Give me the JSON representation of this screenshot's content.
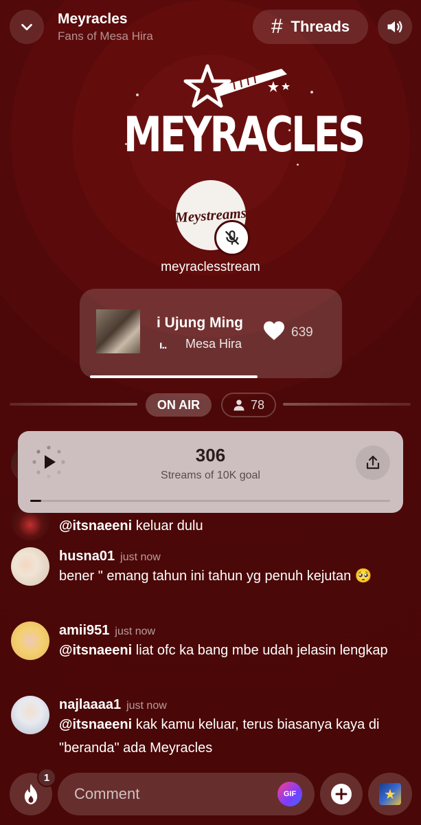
{
  "header": {
    "title": "Meyracles",
    "subtitle": "Fans of Mesa Hira",
    "threads_label": "Threads"
  },
  "logo": {
    "text": "MEYRACLES"
  },
  "host": {
    "avatar_text": "Meystreams",
    "name": "meyraclesstream",
    "muted": true
  },
  "now_playing": {
    "title": "Di Ujung Minggu",
    "title_visible": "i Ujung Ming",
    "artist": "Mesa Hira",
    "bars": "ı..",
    "likes": "639",
    "progress": 0.64
  },
  "status": {
    "on_air_label": "ON AIR",
    "listeners": "78"
  },
  "streams_card": {
    "count": "306",
    "label": "Streams of 10K goal",
    "progress": 0.03
  },
  "messages": [
    {
      "user": "",
      "time": "",
      "mention": "@itsnaeeni",
      "text": " keluar dulu",
      "avatar_colors": [
        "#3a1a1a",
        "#7a2020"
      ]
    },
    {
      "user": "husna01",
      "time": "just now",
      "mention": "",
      "text": "bener \" emang tahun ini tahun yg penuh kejutan 🥺",
      "avatar_colors": [
        "#f0e6da",
        "#d8b8a0"
      ]
    },
    {
      "user": "amii951",
      "time": "just now",
      "mention": "@itsnaeeni",
      "text": " liat ofc ka bang mbe udah jelasin lengkap",
      "avatar_colors": [
        "#f3d070",
        "#e0a0b0"
      ]
    },
    {
      "user": "najlaaaa1",
      "time": "just now",
      "mention": "@itsnaeeni",
      "text": " kak kamu keluar, terus biasanya kaya di \"beranda\" ada Meyracles",
      "avatar_colors": [
        "#e8eaf0",
        "#a0a8c0"
      ]
    }
  ],
  "bottom_bar": {
    "fire_badge": "1",
    "comment_placeholder": "Comment",
    "gif_label": "GIF"
  },
  "colors": {
    "background": "#4a0808",
    "card_overlay": "#cdbfc0"
  }
}
